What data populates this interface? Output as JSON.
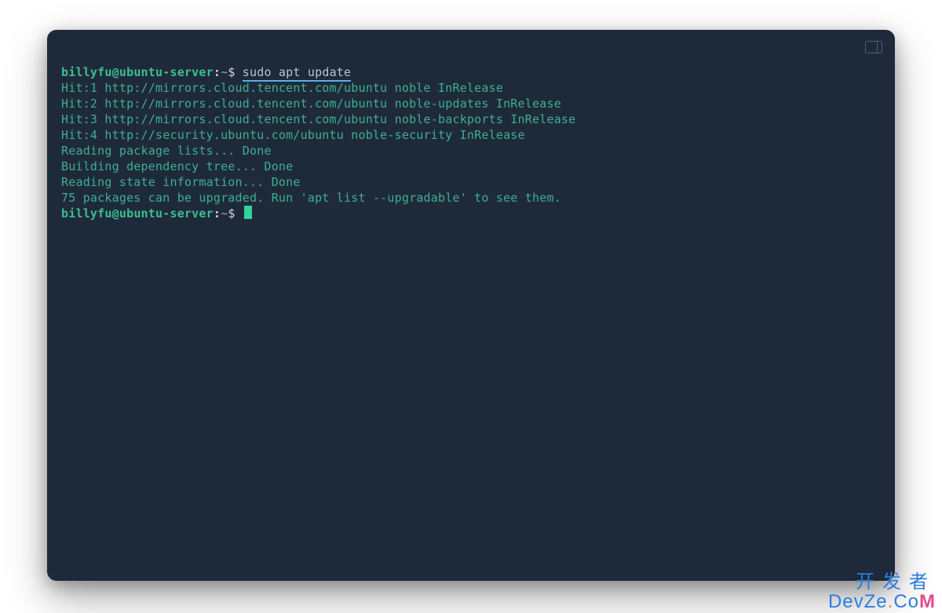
{
  "terminal": {
    "prompt": {
      "user": "billyfu",
      "host": "ubuntu-server",
      "separator_at": "@",
      "separator_colon": ":",
      "path": "~",
      "symbol": "$"
    },
    "command": "sudo apt update",
    "output": [
      "Hit:1 http://mirrors.cloud.tencent.com/ubuntu noble InRelease",
      "Hit:2 http://mirrors.cloud.tencent.com/ubuntu noble-updates InRelease",
      "Hit:3 http://mirrors.cloud.tencent.com/ubuntu noble-backports InRelease",
      "Hit:4 http://security.ubuntu.com/ubuntu noble-security InRelease",
      "Reading package lists... Done",
      "Building dependency tree... Done",
      "Reading state information... Done",
      "75 packages can be upgraded. Run 'apt list --upgradable' to see them."
    ]
  },
  "watermark": {
    "line1": "开发者",
    "brand_prefix": "DevZe",
    "brand_dot": ".",
    "brand_co": "Co",
    "brand_m": "M"
  }
}
